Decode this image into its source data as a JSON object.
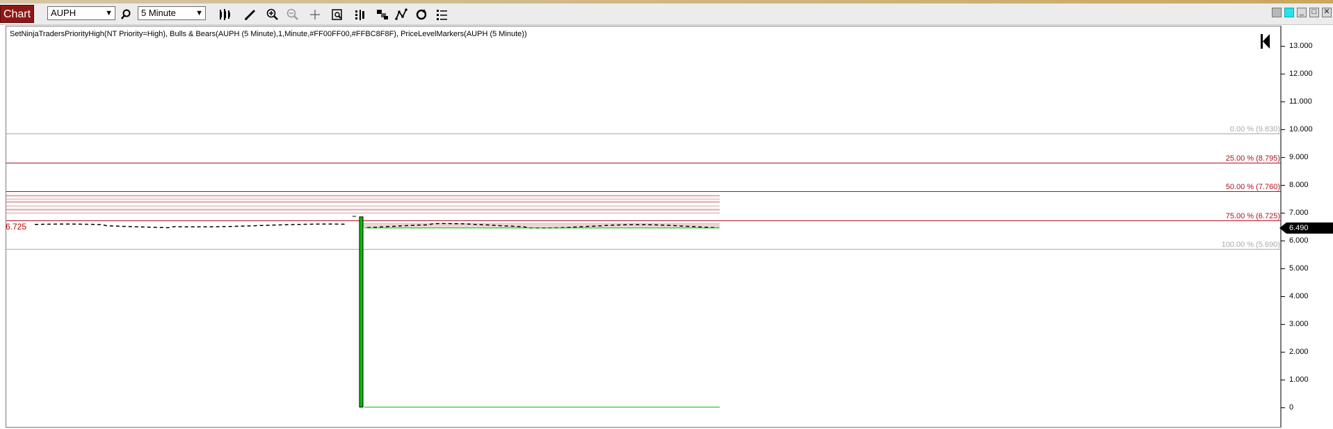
{
  "toolbar": {
    "chart_button": "Chart",
    "instrument": "AUPH",
    "timeframe": "5 Minute",
    "icons": [
      "search-icon",
      "bar-type-icon",
      "draw-pencil-icon",
      "zoom-in-icon",
      "zoom-out-icon",
      "crosshair-icon",
      "data-box-icon",
      "properties-icon",
      "templates-icon",
      "strategies-icon",
      "reload-icon",
      "list-icon"
    ]
  },
  "window_controls": [
    "gray-box",
    "cyan-box",
    "minimize",
    "maximize",
    "close"
  ],
  "indicator_label": "SetNinjaTradersPriorityHigh(NT Priority=High), Bulls & Bears(AUPH (5 Minute),1,Minute,#FF00FF00,#FFBC8F8F), PriceLevelMarkers(AUPH (5 Minute))",
  "price_axis": {
    "labels": [
      "13.000",
      "12.000",
      "11.000",
      "10.000",
      "9.000",
      "8.000",
      "7.000",
      "6.000",
      "5.000",
      "4.000",
      "3.000",
      "2.000",
      "1.000",
      "0"
    ],
    "values": [
      13,
      12,
      11,
      10,
      9,
      8,
      7,
      6,
      5,
      4,
      3,
      2,
      1,
      0
    ],
    "current_price": "6.490"
  },
  "fib_levels": [
    {
      "label": "0.00 % (9.830)",
      "price": 9.83,
      "color": "#aaaaaa"
    },
    {
      "label": "25.00 % (8.795)",
      "price": 8.795,
      "color": "#b01020"
    },
    {
      "label": "50.00 % (7.760)",
      "price": 7.76,
      "color": "#b01020"
    },
    {
      "label": "75.00 % (6.725)",
      "price": 6.725,
      "color": "#b01020"
    },
    {
      "label": "100.00 % (5.690)",
      "price": 5.69,
      "color": "#aaaaaa"
    }
  ],
  "left_level_label": "6.725",
  "colors": {
    "bull": "#00c000",
    "bear": "#bc8f8f",
    "level": "#b01020",
    "chart_button": "#8f1717"
  }
}
